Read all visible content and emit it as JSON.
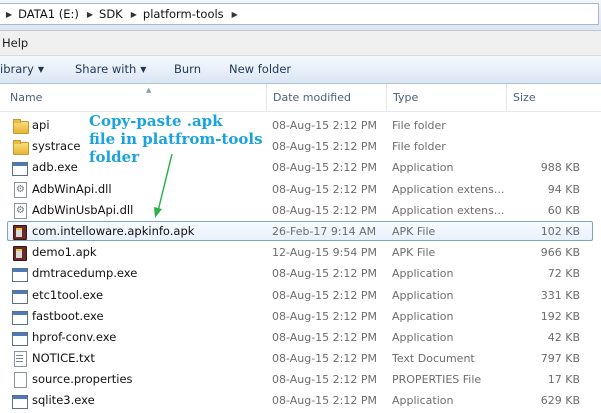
{
  "breadcrumb": [
    {
      "label": "DATA1 (E:)"
    },
    {
      "label": "SDK"
    },
    {
      "label": "platform-tools"
    }
  ],
  "menubar": {
    "help": "Help"
  },
  "commandbar": {
    "library": "ibrary",
    "share_with": "Share with",
    "burn": "Burn",
    "new_folder": "New folder"
  },
  "columns": {
    "name": "Name",
    "date_modified": "Date modified",
    "type": "Type",
    "size": "Size"
  },
  "files": [
    {
      "icon": "folder-icon",
      "name": "api",
      "date": "08-Aug-15 2:12 PM",
      "type": "File folder",
      "size": ""
    },
    {
      "icon": "folder-icon",
      "name": "systrace",
      "date": "08-Aug-15 2:12 PM",
      "type": "File folder",
      "size": ""
    },
    {
      "icon": "exe-icon",
      "name": "adb.exe",
      "date": "08-Aug-15 2:12 PM",
      "type": "Application",
      "size": "988 KB"
    },
    {
      "icon": "dll-icon",
      "name": "AdbWinApi.dll",
      "date": "08-Aug-15 2:12 PM",
      "type": "Application extens...",
      "size": "94 KB"
    },
    {
      "icon": "dll-icon",
      "name": "AdbWinUsbApi.dll",
      "date": "08-Aug-15 2:12 PM",
      "type": "Application extens...",
      "size": "60 KB"
    },
    {
      "icon": "apk-icon",
      "name": "com.intelloware.apkinfo.apk",
      "date": "26-Feb-17 9:14 AM",
      "type": "APK File",
      "size": "102 KB"
    },
    {
      "icon": "apk-icon",
      "name": "demo1.apk",
      "date": "12-Aug-15 9:54 PM",
      "type": "APK File",
      "size": "966 KB"
    },
    {
      "icon": "exe-icon",
      "name": "dmtracedump.exe",
      "date": "08-Aug-15 2:12 PM",
      "type": "Application",
      "size": "72 KB"
    },
    {
      "icon": "exe-icon",
      "name": "etc1tool.exe",
      "date": "08-Aug-15 2:12 PM",
      "type": "Application",
      "size": "331 KB"
    },
    {
      "icon": "exe-icon",
      "name": "fastboot.exe",
      "date": "08-Aug-15 2:12 PM",
      "type": "Application",
      "size": "192 KB"
    },
    {
      "icon": "exe-icon",
      "name": "hprof-conv.exe",
      "date": "08-Aug-15 2:12 PM",
      "type": "Application",
      "size": "42 KB"
    },
    {
      "icon": "text-file-icon",
      "name": "NOTICE.txt",
      "date": "08-Aug-15 2:12 PM",
      "type": "Text Document",
      "size": "797 KB"
    },
    {
      "icon": "file-icon",
      "name": "source.properties",
      "date": "08-Aug-15 2:12 PM",
      "type": "PROPERTIES File",
      "size": "17 KB"
    },
    {
      "icon": "exe-icon",
      "name": "sqlite3.exe",
      "date": "08-Aug-15 2:12 PM",
      "type": "Application",
      "size": "629 KB"
    }
  ],
  "selected_index": 5,
  "annotation": {
    "line1": "Copy-paste .apk",
    "line2": "file in platfrom-tools",
    "line3": "folder",
    "color": "#1aa3dc",
    "arrow_color": "#2bb24c"
  }
}
